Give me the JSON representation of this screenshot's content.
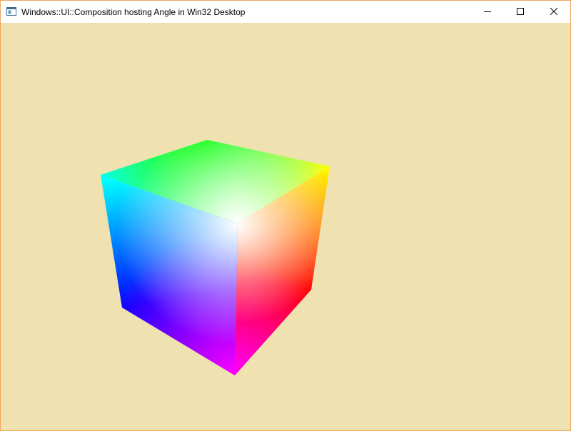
{
  "window": {
    "title": "Windows::UI::Composition hosting Angle in Win32 Desktop",
    "app_icon": "app-window-icon",
    "controls": {
      "minimize_icon": "minimize-icon",
      "maximize_icon": "maximize-icon",
      "close_icon": "close-icon"
    }
  },
  "colors": {
    "background": "#efe1b0",
    "border": "#f0a65c",
    "titlebar": "#ffffff"
  },
  "scene": {
    "object": "rgb-color-cube"
  }
}
